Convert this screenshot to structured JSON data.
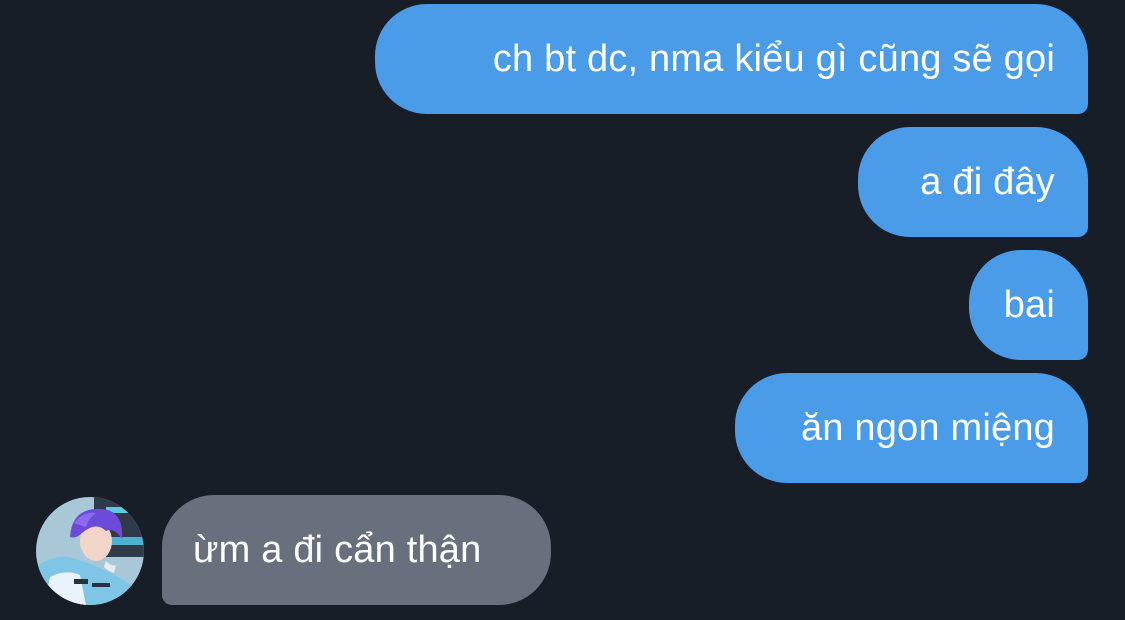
{
  "chat": {
    "messages": [
      {
        "id": "m1",
        "direction": "sent",
        "text": "ch bt dc, nma kiểu gì cũng sẽ gọi"
      },
      {
        "id": "m2",
        "direction": "sent",
        "text": "a đi đây"
      },
      {
        "id": "m3",
        "direction": "sent",
        "text": "bai"
      },
      {
        "id": "m4",
        "direction": "sent",
        "text": "ăn ngon miệng"
      },
      {
        "id": "m5",
        "direction": "received",
        "text": "ừm a đi cẩn thận"
      }
    ],
    "colors": {
      "background": "#171e28",
      "sent_bubble": "#4a9be8",
      "received_bubble": "#67707c",
      "text": "#ffffff"
    }
  }
}
